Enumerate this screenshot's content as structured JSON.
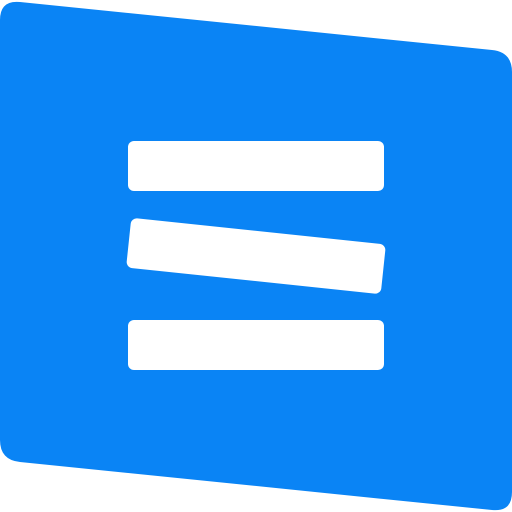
{
  "logo": {
    "icon": "hamburger-menu-icon",
    "colors": {
      "background": "#0a84f5",
      "bars": "#ffffff"
    }
  }
}
